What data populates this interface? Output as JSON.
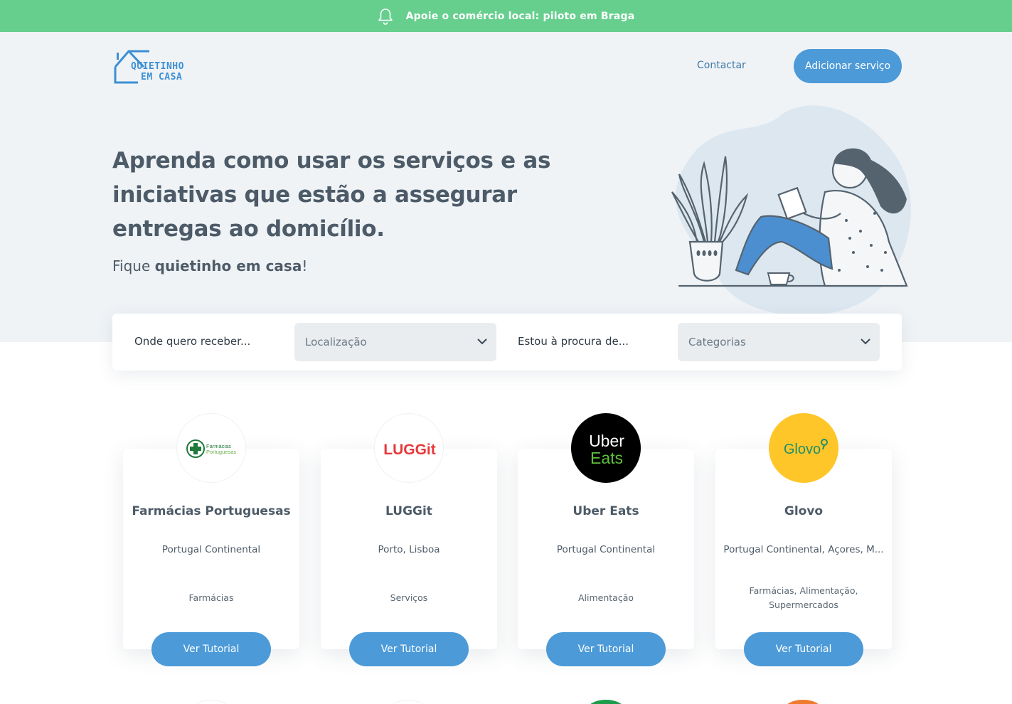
{
  "banner": {
    "text": "Apoie o comércio local: piloto em Braga",
    "icon": "bell-icon"
  },
  "logo": {
    "line1": "QUIETINHO",
    "line2": "EM CASA"
  },
  "nav": {
    "contact": "Contactar",
    "add_service": "Adicionar serviço"
  },
  "hero": {
    "headline": "Aprenda como usar os serviços e as iniciativas que estão a assegurar entregas ao domicílio.",
    "sub_prefix": "Fique ",
    "sub_bold": "quietinho em casa",
    "sub_suffix": "!"
  },
  "search": {
    "location_label": "Onde quero receber...",
    "location_placeholder": "Localização",
    "category_label": "Estou à procura de...",
    "category_placeholder": "Categorias"
  },
  "cards": [
    {
      "title": "Farmácias Portuguesas",
      "region": "Portugal Continental",
      "categories": "Farmácias",
      "button": "Ver Tutorial",
      "logo_line1": "Farmácias",
      "logo_line2": "Portuguesas"
    },
    {
      "title": "LUGGit",
      "region": "Porto, Lisboa",
      "categories": "Serviços",
      "button": "Ver Tutorial",
      "logo_text": "LUGGit"
    },
    {
      "title": "Uber Eats",
      "region": "Portugal Continental",
      "categories": "Alimentação",
      "button": "Ver Tutorial",
      "logo_line1": "Uber",
      "logo_line2": "Eats"
    },
    {
      "title": "Glovo",
      "region": "Portugal Continental, Açores, M...",
      "categories": "Farmácias, Alimentação, Supermercados",
      "button": "Ver Tutorial",
      "logo_text": "Glovo"
    }
  ],
  "colors": {
    "banner": "#66cf8e",
    "accent": "#4c9ad8",
    "hero_bg": "#eff3f6",
    "text": "#4d5b68"
  }
}
